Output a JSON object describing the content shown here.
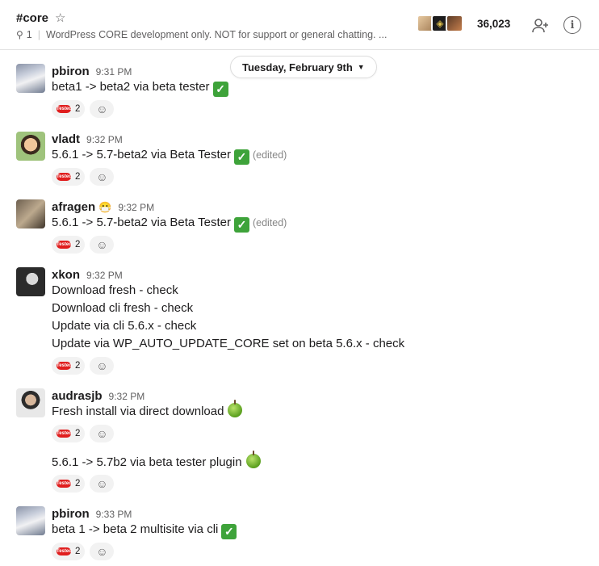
{
  "channel": {
    "name": "#core",
    "pinned_count": "1",
    "topic": "WordPress CORE development only. NOT for support or general chatting. ...",
    "member_count": "36,023"
  },
  "date_divider": "Tuesday, February 9th",
  "reaction_label": "Tested",
  "messages": [
    {
      "user": "pbiron",
      "status": "",
      "time": "9:31 PM",
      "lines": [
        "beta1 -> beta2 via beta tester"
      ],
      "emoji": "check",
      "edited": "",
      "reaction_count": "2"
    },
    {
      "user": "vladt",
      "status": "",
      "time": "9:32 PM",
      "lines": [
        "5.6.1 -> 5.7-beta2 via Beta Tester"
      ],
      "emoji": "check",
      "edited": "(edited)",
      "reaction_count": "2"
    },
    {
      "user": "afragen",
      "status": "😷",
      "time": "9:32 PM",
      "lines": [
        "5.6.1 -> 5.7-beta2 via Beta Tester"
      ],
      "emoji": "check",
      "edited": "(edited)",
      "reaction_count": "2"
    },
    {
      "user": "xkon",
      "status": "",
      "time": "9:32 PM",
      "lines": [
        "Download fresh - check",
        "Download cli fresh - check",
        "Update via cli 5.6.x - check",
        "Update via WP_AUTO_UPDATE_CORE set on beta  5.6.x - check"
      ],
      "emoji": "",
      "edited": "",
      "reaction_count": "2"
    },
    {
      "user": "audrasjb",
      "status": "",
      "time": "9:32 PM",
      "lines": [
        "Fresh install via direct download"
      ],
      "emoji": "apple",
      "edited": "",
      "reaction_count": "2"
    },
    {
      "user": "",
      "status": "",
      "time": "",
      "lines": [
        "5.6.1 -> 5.7b2 via beta tester plugin"
      ],
      "emoji": "apple",
      "edited": "",
      "reaction_count": "2"
    },
    {
      "user": "pbiron",
      "status": "",
      "time": "9:33 PM",
      "lines": [
        "beta 1 -> beta 2 multisite via cli"
      ],
      "emoji": "check",
      "edited": "",
      "reaction_count": "2"
    }
  ]
}
